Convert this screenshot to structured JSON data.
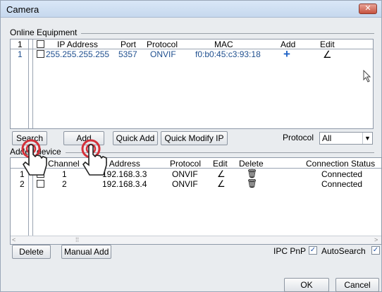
{
  "window": {
    "title": "Camera",
    "close_icon": "✕"
  },
  "online": {
    "label": "Online Equipment",
    "columns": {
      "index": "1",
      "ip": "IP Address",
      "port": "Port",
      "protocol": "Protocol",
      "mac": "MAC",
      "add": "Add",
      "edit": "Edit"
    },
    "rows": [
      {
        "index": "1",
        "ip": "255.255.255.255",
        "port": "5357",
        "protocol": "ONVIF",
        "mac": "f0:b0:45:c3:93:18",
        "add": "+",
        "edit": "∠"
      }
    ]
  },
  "toolbar": {
    "search": "Search",
    "add": "Add",
    "quick_add": "Quick Add",
    "quick_modify": "Quick Modify IP",
    "protocol_label": "Protocol",
    "protocol_value": "All"
  },
  "added": {
    "label": "Added device",
    "columns": {
      "channel": "Channel",
      "ip": "IP Address",
      "protocol": "Protocol",
      "edit": "Edit",
      "delete": "Delete",
      "status": "Connection Status"
    },
    "rows": [
      {
        "index": "1",
        "channel": "1",
        "ip": "192.168.3.3",
        "protocol": "ONVIF",
        "edit": "∠",
        "delete": "🗑",
        "status": "Connected"
      },
      {
        "index": "2",
        "channel": "2",
        "ip": "192.168.3.4",
        "protocol": "ONVIF",
        "edit": "∠",
        "delete": "🗑",
        "status": "Connected"
      }
    ]
  },
  "bottom": {
    "delete": "Delete",
    "manual_add": "Manual Add",
    "ipc_pnp": "IPC PnP",
    "auto_search": "AutoSearch",
    "ok": "OK",
    "cancel": "Cancel"
  }
}
